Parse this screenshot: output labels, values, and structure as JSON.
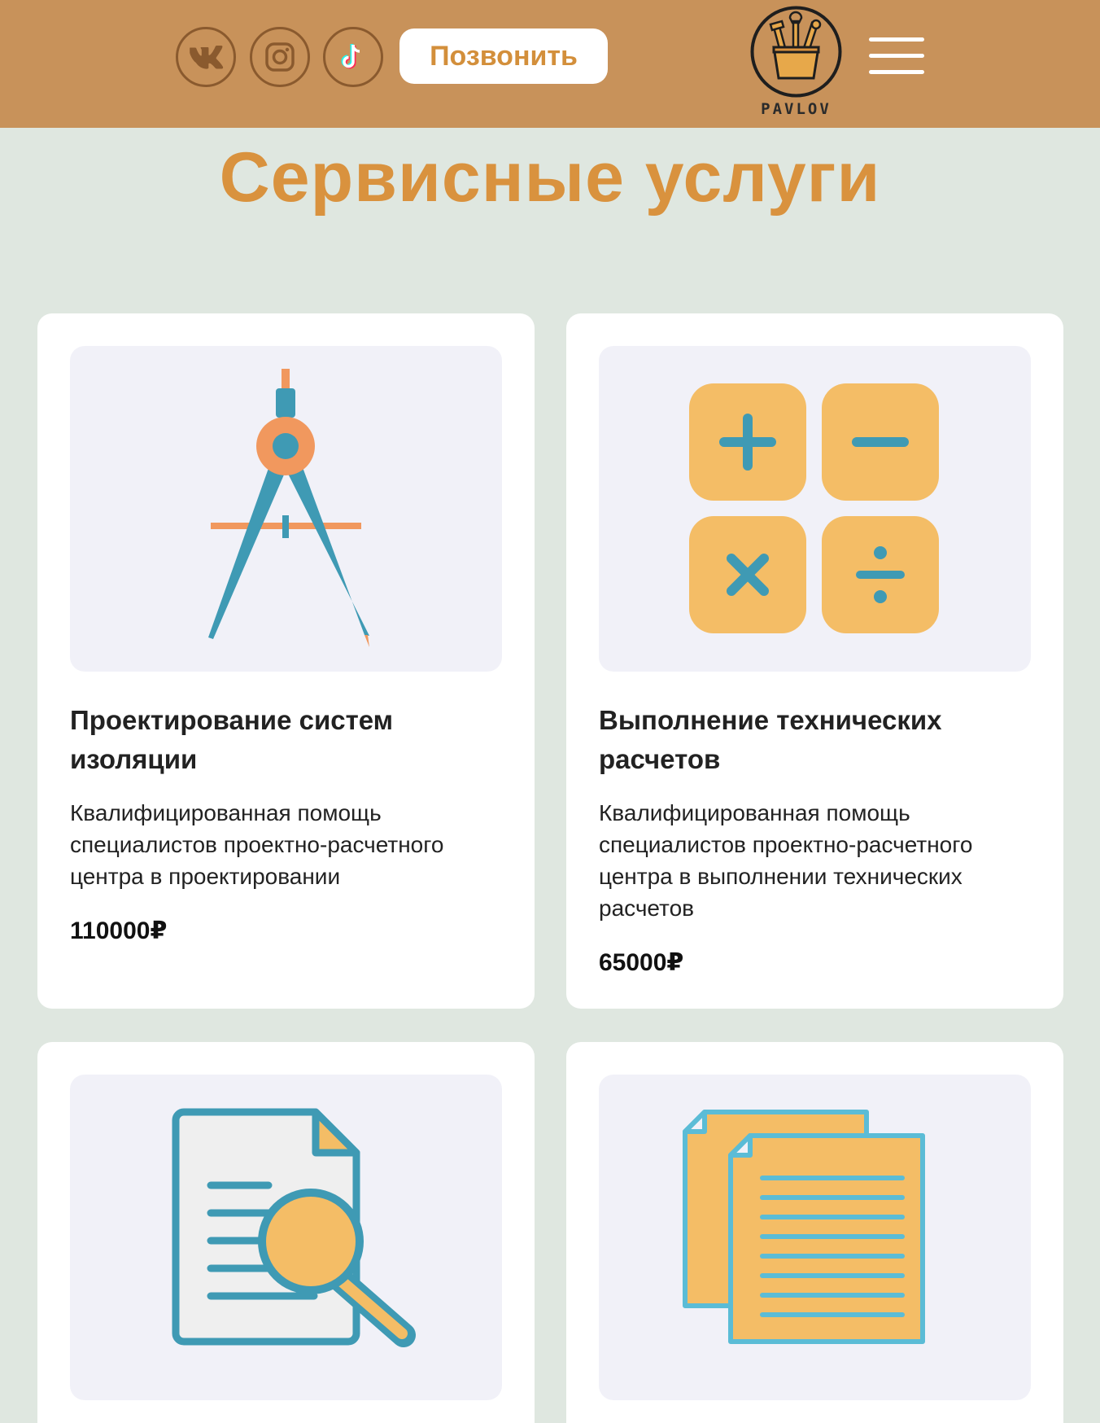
{
  "header": {
    "social": [
      {
        "name": "vk-icon",
        "label": "VK"
      },
      {
        "name": "instagram-icon",
        "label": "Instagram"
      },
      {
        "name": "tiktok-icon",
        "label": "TikTok"
      }
    ],
    "call_button": "Позвонить",
    "logo_text": "PAVLOV"
  },
  "colors": {
    "header_bg": "#c8925a",
    "page_bg": "#dfe7e0",
    "accent": "#d9923e",
    "icon_teal": "#3f9ab4",
    "icon_orange": "#f4bd66"
  },
  "page": {
    "title": "Сервисные услуги"
  },
  "services": [
    {
      "icon": "compass-icon",
      "title": "Проектирование систем изоляции",
      "description": "Квалифицированная помощь специалистов проектно-расчетного центра в проектировании",
      "price": "110000₽"
    },
    {
      "icon": "calculator-icon",
      "title": "Выполнение технических расчетов",
      "description": "Квалифицированная помощь специалистов проектно-расчетного центра в выполнении технических расчетов",
      "price": "65000₽"
    },
    {
      "icon": "document-search-icon",
      "title": "",
      "description": "",
      "price": ""
    },
    {
      "icon": "documents-icon",
      "title": "",
      "description": "",
      "price": ""
    }
  ]
}
